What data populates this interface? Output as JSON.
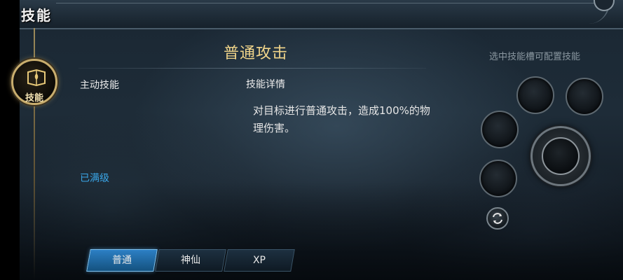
{
  "header": {
    "title": "技能"
  },
  "sidebar": {
    "skill_tab_label": "技能"
  },
  "skill_panel": {
    "skill_name": "普通攻击",
    "active_skill_label": "主动技能",
    "detail_label": "技能详情",
    "detail_text": "对目标进行普通攻击，造成100%的物理伤害。",
    "level_status": "已满级"
  },
  "tabs": [
    {
      "label": "普通",
      "active": true
    },
    {
      "label": "神仙",
      "active": false
    },
    {
      "label": "XP",
      "active": false
    }
  ],
  "slots_panel": {
    "hint": "选中技能槽可配置技能"
  },
  "colors": {
    "gold_title": "#f1d58a",
    "max_level_blue": "#3aa6e8",
    "active_tab": "#2c7fc4"
  }
}
